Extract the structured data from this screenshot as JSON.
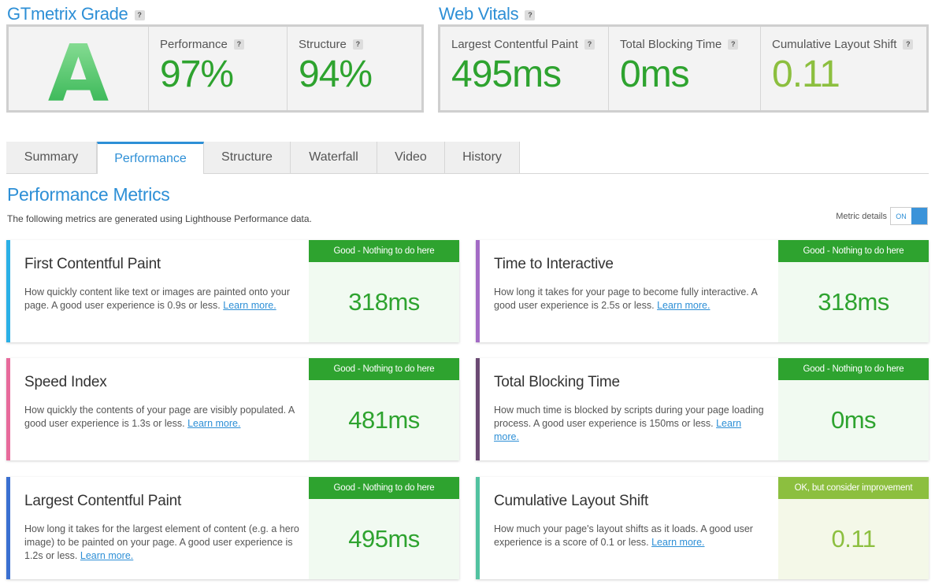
{
  "grade": {
    "title": "GTmetrix Grade",
    "help": "?",
    "letter": "A",
    "performance_label": "Performance",
    "performance_value": "97%",
    "structure_label": "Structure",
    "structure_value": "94%"
  },
  "vitals": {
    "title": "Web Vitals",
    "help": "?",
    "lcp_label": "Largest Contentful Paint",
    "lcp_value": "495ms",
    "tbt_label": "Total Blocking Time",
    "tbt_value": "0ms",
    "cls_label": "Cumulative Layout Shift",
    "cls_value": "0.11"
  },
  "tabs": [
    "Summary",
    "Performance",
    "Structure",
    "Waterfall",
    "Video",
    "History"
  ],
  "active_tab": "Performance",
  "metrics_section": {
    "title": "Performance Metrics",
    "subtitle": "The following metrics are generated using Lighthouse Performance data.",
    "details_label": "Metric details",
    "toggle_state": "ON"
  },
  "cards": [
    {
      "name": "First Contentful Paint",
      "desc": "How quickly content like text or images are painted onto your page. A good user experience is 0.9s or less.",
      "link": "Learn more.",
      "badge": "Good - Nothing to do here",
      "value": "318ms",
      "color": "#2bb0e6"
    },
    {
      "name": "Time to Interactive",
      "desc": "How long it takes for your page to become fully interactive. A good user experience is 2.5s or less.",
      "link": "Learn more.",
      "badge": "Good - Nothing to do here",
      "value": "318ms",
      "color": "#a36bc5"
    },
    {
      "name": "Speed Index",
      "desc": "How quickly the contents of your page are visibly populated. A good user experience is 1.3s or less.",
      "link": "Learn more.",
      "badge": "Good - Nothing to do here",
      "value": "481ms",
      "color": "#e76a9b"
    },
    {
      "name": "Total Blocking Time",
      "desc": "How much time is blocked by scripts during your page loading process. A good user experience is 150ms or less.",
      "link": "Learn more.",
      "badge": "Good - Nothing to do here",
      "value": "0ms",
      "color": "#6b4a73"
    },
    {
      "name": "Largest Contentful Paint",
      "desc": "How long it takes for the largest element of content (e.g. a hero image) to be painted on your page. A good user experience is 1.2s or less.",
      "link": "Learn more.",
      "badge": "Good - Nothing to do here",
      "value": "495ms",
      "color": "#3a6fd0"
    },
    {
      "name": "Cumulative Layout Shift",
      "desc": "How much your page's layout shifts as it loads. A good user experience is a score of 0.1 or less.",
      "link": "Learn more.",
      "badge": "OK, but consider improvement",
      "value": "0.11",
      "color": "#52c2a0"
    }
  ]
}
